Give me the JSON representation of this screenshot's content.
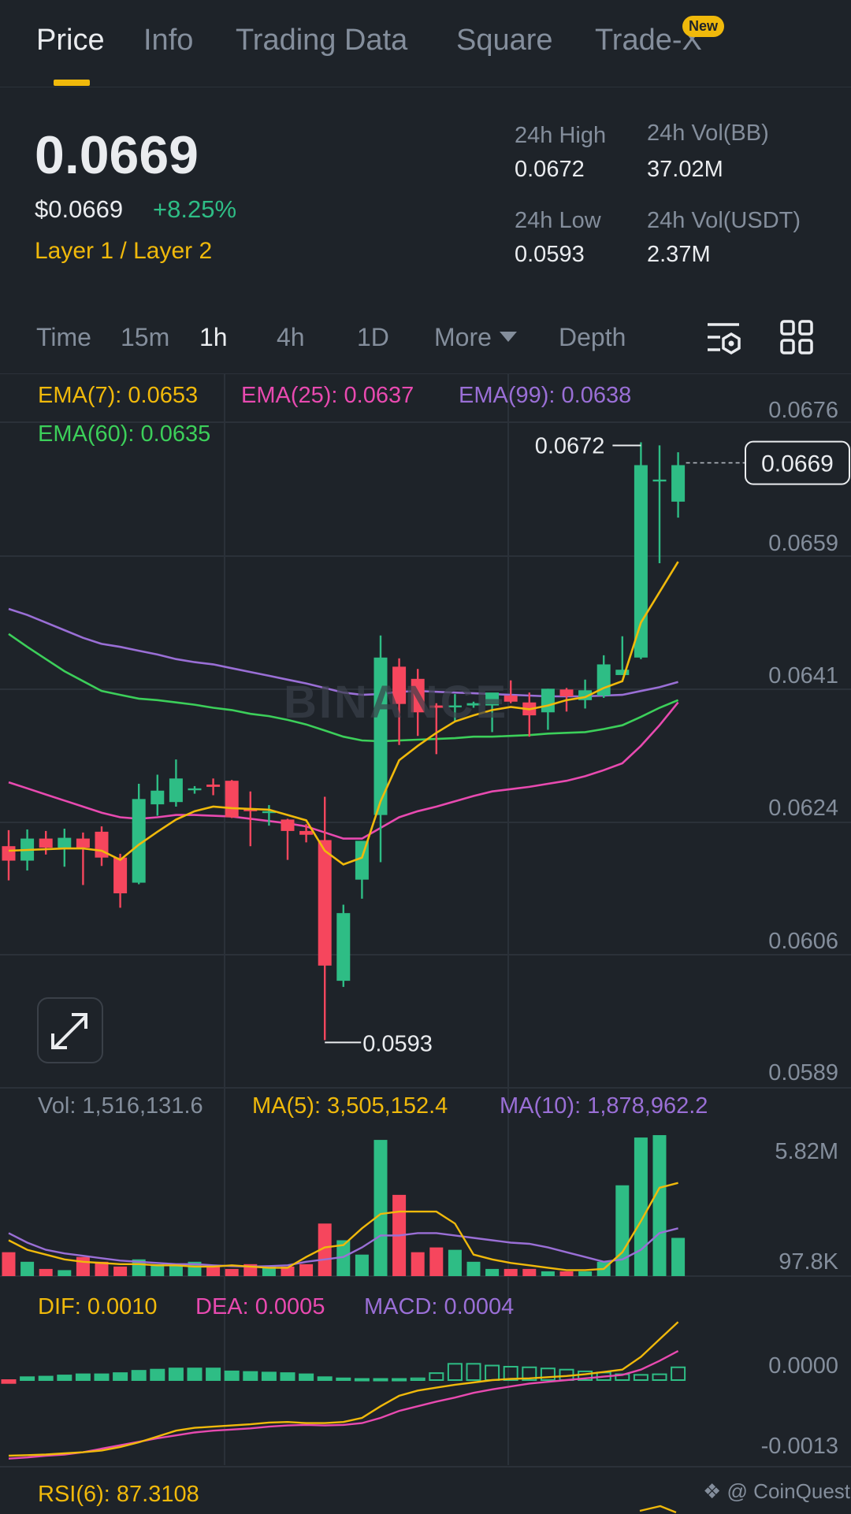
{
  "tabs": [
    {
      "label": "Price",
      "active": true
    },
    {
      "label": "Info",
      "active": false
    },
    {
      "label": "Trading Data",
      "active": false
    },
    {
      "label": "Square",
      "active": false
    },
    {
      "label": "Trade-X",
      "active": false,
      "badge": "New"
    }
  ],
  "summary": {
    "last_price": "0.0669",
    "fiat_price": "$0.0669",
    "change_pct": "+8.25%",
    "category": "Layer 1 / Layer 2",
    "high_label": "24h High",
    "high_value": "0.0672",
    "low_label": "24h Low",
    "low_value": "0.0593",
    "vol_base_label": "24h Vol(BB)",
    "vol_base_value": "37.02M",
    "vol_quote_label": "24h Vol(USDT)",
    "vol_quote_value": "2.37M"
  },
  "timeframes": {
    "time": "Time",
    "m15": "15m",
    "h1": "1h",
    "h4": "4h",
    "d1": "1D",
    "more": "More",
    "depth": "Depth",
    "selected": "1h"
  },
  "indicators": {
    "ema7": "EMA(7): 0.0653",
    "ema25": "EMA(25): 0.0637",
    "ema99": "EMA(99): 0.0638",
    "ema60": "EMA(60): 0.0635",
    "vol": "Vol: 1,516,131.6",
    "ma5": "MA(5): 3,505,152.4",
    "ma10": "MA(10): 1,878,962.2",
    "dif": "DIF: 0.0010",
    "dea": "DEA: 0.0005",
    "macd": "MACD: 0.0004",
    "rsi": "RSI(6): 87.3108"
  },
  "colors": {
    "up": "#2ebd85",
    "down": "#f6465d",
    "ema7": "#f0b90b",
    "ema25": "#e84ab0",
    "ema99": "#9a6fd6",
    "ema60": "#3ccf5a",
    "accent": "#f0b90b"
  },
  "watermark": "BINANCE",
  "credit": "@ CoinQuest",
  "icons": [
    "chart-settings-icon",
    "grid-layout-icon",
    "expand-icon",
    "chevron-down-icon"
  ],
  "chart_data": {
    "type": "candlestick",
    "interval": "1h",
    "price_axis_ticks": [
      "0.0676",
      "0.0659",
      "0.0641",
      "0.0624",
      "0.0606",
      "0.0589"
    ],
    "ylim": [
      0.0589,
      0.0676
    ],
    "current_price_label": "0.0669",
    "high_marker": "0.0672",
    "low_marker": "0.0593",
    "candles": [
      {
        "o": 0.06186,
        "h": 0.06207,
        "l": 0.06141,
        "c": 0.06167
      },
      {
        "o": 0.06167,
        "h": 0.06208,
        "l": 0.06154,
        "c": 0.06196
      },
      {
        "o": 0.06196,
        "h": 0.06206,
        "l": 0.06175,
        "c": 0.06184
      },
      {
        "o": 0.06184,
        "h": 0.06209,
        "l": 0.06159,
        "c": 0.06197
      },
      {
        "o": 0.06196,
        "h": 0.06204,
        "l": 0.06135,
        "c": 0.06184
      },
      {
        "o": 0.06205,
        "h": 0.06212,
        "l": 0.0616,
        "c": 0.06171
      },
      {
        "o": 0.06171,
        "h": 0.06176,
        "l": 0.06105,
        "c": 0.06124
      },
      {
        "o": 0.06138,
        "h": 0.06268,
        "l": 0.06136,
        "c": 0.06248
      },
      {
        "o": 0.06241,
        "h": 0.0628,
        "l": 0.06226,
        "c": 0.06259
      },
      {
        "o": 0.06244,
        "h": 0.063,
        "l": 0.06238,
        "c": 0.06275
      },
      {
        "o": 0.06262,
        "h": 0.06265,
        "l": 0.06255,
        "c": 0.06262
      },
      {
        "o": 0.06267,
        "h": 0.06275,
        "l": 0.06253,
        "c": 0.06264
      },
      {
        "o": 0.06272,
        "h": 0.06273,
        "l": 0.06223,
        "c": 0.06224
      },
      {
        "o": 0.06235,
        "h": 0.06258,
        "l": 0.06186,
        "c": 0.06232
      },
      {
        "o": 0.06232,
        "h": 0.0624,
        "l": 0.06213,
        "c": 0.06232
      },
      {
        "o": 0.06221,
        "h": 0.06222,
        "l": 0.06168,
        "c": 0.06206
      },
      {
        "o": 0.06206,
        "h": 0.06215,
        "l": 0.06191,
        "c": 0.06201
      },
      {
        "o": 0.06194,
        "h": 0.06251,
        "l": 0.05931,
        "c": 0.06029
      },
      {
        "o": 0.06009,
        "h": 0.06109,
        "l": 0.06001,
        "c": 0.06098
      },
      {
        "o": 0.06142,
        "h": 0.06193,
        "l": 0.06117,
        "c": 0.06193
      },
      {
        "o": 0.06227,
        "h": 0.06463,
        "l": 0.06165,
        "c": 0.06434
      },
      {
        "o": 0.06422,
        "h": 0.06433,
        "l": 0.06319,
        "c": 0.06373
      },
      {
        "o": 0.06406,
        "h": 0.06419,
        "l": 0.06331,
        "c": 0.06362
      },
      {
        "o": 0.06371,
        "h": 0.06374,
        "l": 0.06307,
        "c": 0.06368
      },
      {
        "o": 0.06369,
        "h": 0.06386,
        "l": 0.0635,
        "c": 0.06371
      },
      {
        "o": 0.06371,
        "h": 0.06376,
        "l": 0.06368,
        "c": 0.06374
      },
      {
        "o": 0.06371,
        "h": 0.06384,
        "l": 0.06336,
        "c": 0.06388
      },
      {
        "o": 0.06384,
        "h": 0.06404,
        "l": 0.06374,
        "c": 0.06376
      },
      {
        "o": 0.06375,
        "h": 0.06388,
        "l": 0.0633,
        "c": 0.06358
      },
      {
        "o": 0.06362,
        "h": 0.06393,
        "l": 0.06339,
        "c": 0.06393
      },
      {
        "o": 0.06392,
        "h": 0.06394,
        "l": 0.06363,
        "c": 0.06383
      },
      {
        "o": 0.06378,
        "h": 0.06405,
        "l": 0.06367,
        "c": 0.06391
      },
      {
        "o": 0.06384,
        "h": 0.06437,
        "l": 0.06381,
        "c": 0.06425
      },
      {
        "o": 0.06411,
        "h": 0.06462,
        "l": 0.06411,
        "c": 0.06418
      },
      {
        "o": 0.06434,
        "h": 0.06717,
        "l": 0.06432,
        "c": 0.06687
      },
      {
        "o": 0.06668,
        "h": 0.06713,
        "l": 0.06558,
        "c": 0.06668
      },
      {
        "o": 0.06639,
        "h": 0.06704,
        "l": 0.06618,
        "c": 0.06687
      }
    ],
    "ema7": [
      0.0618,
      0.06181,
      0.06182,
      0.06183,
      0.06183,
      0.0618,
      0.06168,
      0.06188,
      0.06205,
      0.06221,
      0.06232,
      0.06238,
      0.06236,
      0.06235,
      0.06234,
      0.06227,
      0.0622,
      0.0618,
      0.06162,
      0.06171,
      0.06245,
      0.06299,
      0.06318,
      0.06335,
      0.0635,
      0.06358,
      0.06365,
      0.06369,
      0.06366,
      0.06371,
      0.06378,
      0.06382,
      0.06394,
      0.06403,
      0.0648,
      0.0652,
      0.0656
    ],
    "ema25": [
      0.0627,
      0.06262,
      0.06254,
      0.06246,
      0.06238,
      0.0623,
      0.06224,
      0.06222,
      0.06224,
      0.06227,
      0.06227,
      0.06226,
      0.06225,
      0.06222,
      0.06219,
      0.06216,
      0.06212,
      0.06204,
      0.06196,
      0.06196,
      0.0621,
      0.06224,
      0.06232,
      0.06238,
      0.06245,
      0.06252,
      0.06258,
      0.06261,
      0.06264,
      0.06268,
      0.06272,
      0.06278,
      0.06286,
      0.06295,
      0.06318,
      0.06345,
      0.06375
    ],
    "ema60": [
      0.06465,
      0.06448,
      0.06432,
      0.06416,
      0.06403,
      0.0639,
      0.06385,
      0.0638,
      0.06378,
      0.06375,
      0.06372,
      0.06368,
      0.06365,
      0.0636,
      0.06357,
      0.06352,
      0.06346,
      0.06338,
      0.0633,
      0.06325,
      0.06324,
      0.06325,
      0.06326,
      0.06327,
      0.06328,
      0.0633,
      0.0633,
      0.06331,
      0.06332,
      0.06334,
      0.06335,
      0.06336,
      0.0634,
      0.06345,
      0.06356,
      0.06368,
      0.06378
    ],
    "ema99": [
      0.06498,
      0.0649,
      0.0648,
      0.0647,
      0.0646,
      0.06452,
      0.06448,
      0.06443,
      0.06438,
      0.06432,
      0.06428,
      0.06425,
      0.0642,
      0.06415,
      0.0641,
      0.06405,
      0.064,
      0.06394,
      0.06388,
      0.06385,
      0.06386,
      0.06389,
      0.0639,
      0.06389,
      0.06388,
      0.06387,
      0.06386,
      0.06385,
      0.06384,
      0.06383,
      0.06383,
      0.06383,
      0.06384,
      0.06385,
      0.0639,
      0.06395,
      0.06402
    ],
    "volume_axis_ticks": [
      "5.82M",
      "97.8K"
    ],
    "volume_ylim": [
      0,
      6000000
    ],
    "volume": [
      1000000,
      600000,
      300000,
      250000,
      800000,
      600000,
      400000,
      700000,
      500000,
      500000,
      600000,
      400000,
      300000,
      500000,
      400000,
      400000,
      500000,
      2200000,
      1500000,
      900000,
      5700000,
      3400000,
      1000000,
      1200000,
      1100000,
      600000,
      300000,
      300000,
      300000,
      200000,
      200000,
      200000,
      600000,
      3800000,
      5800000,
      5900000,
      1600000
    ],
    "vol_ma5": [
      1500000,
      1100000,
      900000,
      700000,
      600000,
      550000,
      500000,
      500000,
      450000,
      450000,
      400000,
      400000,
      450000,
      400000,
      350000,
      350000,
      800000,
      1200000,
      1300000,
      2000000,
      2600000,
      2700000,
      2700000,
      2700000,
      2200000,
      900000,
      700000,
      550000,
      450000,
      350000,
      250000,
      250000,
      300000,
      1000000,
      2300000,
      3700000,
      3900000
    ],
    "vol_ma10": [
      1800000,
      1400000,
      1100000,
      950000,
      850000,
      750000,
      650000,
      600000,
      550000,
      500000,
      500000,
      450000,
      420000,
      400000,
      420000,
      450000,
      600000,
      700000,
      800000,
      1200000,
      1700000,
      1700000,
      1800000,
      1800000,
      1700000,
      1600000,
      1500000,
      1400000,
      1350000,
      1200000,
      1000000,
      800000,
      600000,
      700000,
      1100000,
      1800000,
      2000000
    ],
    "macd_axis_ticks": [
      "0.0000",
      "-0.0013"
    ],
    "macd_ylim": [
      -0.0014,
      0.0011
    ],
    "dif": [
      -0.0013,
      -0.00129,
      -0.00128,
      -0.00126,
      -0.00124,
      -0.00121,
      -0.00115,
      -0.00107,
      -0.00097,
      -0.00087,
      -0.00082,
      -0.0008,
      -0.00078,
      -0.00076,
      -0.00073,
      -0.00072,
      -0.00074,
      -0.00074,
      -0.00072,
      -0.00065,
      -0.00045,
      -0.00027,
      -0.00018,
      -0.00013,
      -8e-05,
      -4e-05,
      0.0,
      2e-05,
      3e-05,
      5e-05,
      7e-05,
      0.0001,
      0.00014,
      0.00018,
      0.0004,
      0.0007,
      0.001
    ],
    "dea": [
      -0.00135,
      -0.00133,
      -0.0013,
      -0.00128,
      -0.00124,
      -0.00118,
      -0.00112,
      -0.00106,
      -0.001,
      -0.00095,
      -0.0009,
      -0.00087,
      -0.00085,
      -0.00083,
      -0.0008,
      -0.00078,
      -0.00077,
      -0.00078,
      -0.00077,
      -0.00074,
      -0.00065,
      -0.00053,
      -0.00045,
      -0.00037,
      -0.0003,
      -0.00022,
      -0.00016,
      -0.00011,
      -6e-05,
      -3e-05,
      0.0,
      3e-05,
      6e-05,
      9e-05,
      0.00018,
      0.00033,
      0.0005
    ],
    "macd_hist": [
      -5e-05,
      5e-05,
      6e-05,
      8e-05,
      0.0001,
      0.0001,
      0.00012,
      0.00016,
      0.00018,
      0.0002,
      0.0002,
      0.0002,
      0.00015,
      0.00014,
      0.00013,
      0.00012,
      0.0001,
      5e-05,
      3e-05,
      2e-05,
      2e-05,
      2e-05,
      3e-05,
      0.00012,
      0.00028,
      0.00028,
      0.00025,
      0.00023,
      0.00022,
      0.0002,
      0.00018,
      0.00015,
      0.00013,
      0.0001,
      9e-05,
      0.0001,
      0.00022
    ]
  }
}
